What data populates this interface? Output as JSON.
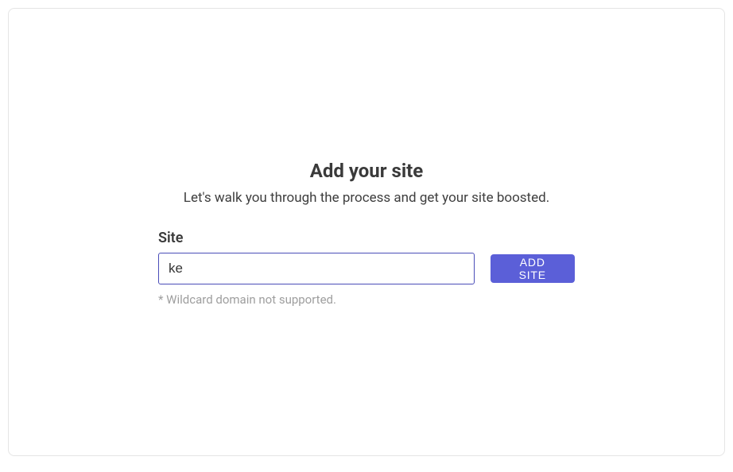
{
  "page": {
    "title": "Add your site",
    "subtitle": "Let's walk you through the process and get your site boosted."
  },
  "form": {
    "site_label": "Site",
    "site_value": "ke",
    "helper_text": "* Wildcard domain not supported.",
    "add_button_label": "ADD SITE"
  }
}
